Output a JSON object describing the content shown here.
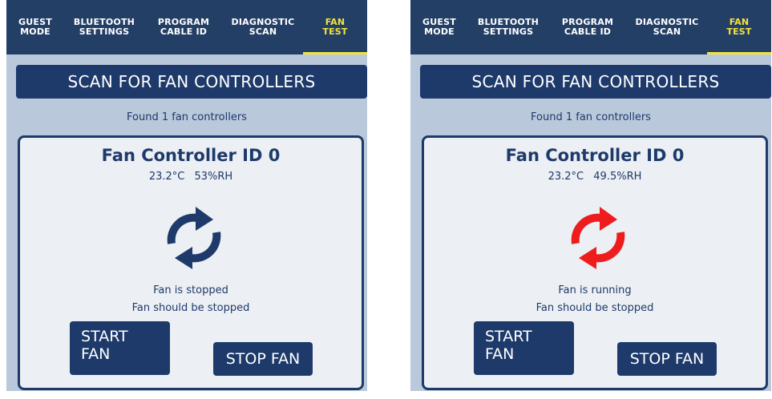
{
  "tabs": [
    {
      "label": "GUEST\nMODE",
      "active": false
    },
    {
      "label": "BLUETOOTH\nSETTINGS",
      "active": false
    },
    {
      "label": "PROGRAM\nCABLE ID",
      "active": false
    },
    {
      "label": "DIAGNOSTIC\nSCAN",
      "active": false
    },
    {
      "label": "FAN\nTEST",
      "active": true
    }
  ],
  "colors": {
    "background": "#b9c8da",
    "navy": "#1d3a6b",
    "tabbar": "#233f66",
    "active_tab": "#f2e33c",
    "icon_stopped": "#1d3a6b",
    "icon_running": "#ee1c1c"
  },
  "screens": [
    {
      "scan_button": "SCAN FOR FAN CONTROLLERS",
      "found_text": "Found 1 fan controllers",
      "controller": {
        "title": "Fan Controller ID 0",
        "temperature": "23.2°C",
        "humidity": "53%RH",
        "icon": "refresh-icon",
        "icon_color": "#1d3a6b",
        "status": "Fan is stopped",
        "expected": "Fan should be stopped"
      },
      "start_button": "START\nFAN",
      "stop_button": "STOP FAN"
    },
    {
      "scan_button": "SCAN FOR FAN CONTROLLERS",
      "found_text": "Found 1 fan controllers",
      "controller": {
        "title": "Fan Controller ID 0",
        "temperature": "23.2°C",
        "humidity": "49.5%RH",
        "icon": "refresh-icon",
        "icon_color": "#ee1c1c",
        "status": "Fan is running",
        "expected": "Fan should be stopped"
      },
      "start_button": "START\nFAN",
      "stop_button": "STOP FAN"
    }
  ]
}
